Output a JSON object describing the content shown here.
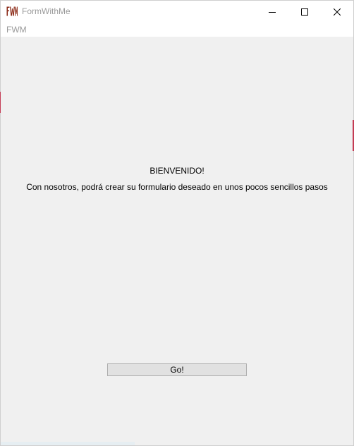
{
  "window": {
    "title": "FormWithMe",
    "icon": "fwm-logo-icon"
  },
  "menubar": {
    "items": [
      {
        "label": "FWM"
      }
    ]
  },
  "main": {
    "welcome_title": "BIENVENIDO!",
    "welcome_text": "Con nosotros, podrá crear su formulario deseado en unos pocos sencillos pasos",
    "go_button_label": "Go!"
  },
  "colors": {
    "background": "#f0f0f0",
    "titlebar": "#ffffff",
    "muted_text": "#9a9a9a",
    "button_face": "#e1e1e1",
    "logo": "#8b2a17"
  }
}
